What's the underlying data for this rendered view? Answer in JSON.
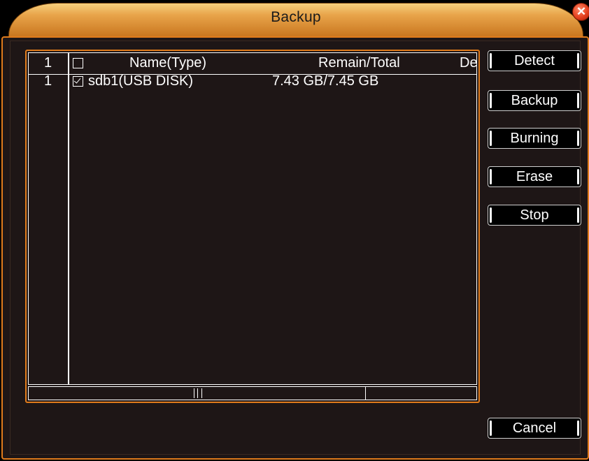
{
  "window": {
    "title": "Backup",
    "close_icon": "close-icon"
  },
  "table": {
    "headers": {
      "index": "1",
      "name": "Name(Type)",
      "remain_total": "Remain/Total",
      "desc": "De"
    },
    "rows": [
      {
        "index": "1",
        "checked": true,
        "name": "sdb1(USB DISK)",
        "remain_total": "7.43 GB/7.45 GB"
      }
    ]
  },
  "buttons": {
    "detect": "Detect",
    "backup": "Backup",
    "burning": "Burning",
    "erase": "Erase",
    "stop": "Stop",
    "cancel": "Cancel"
  },
  "colors": {
    "accent": "#e07b1c",
    "panel_bg": "#1e1616",
    "close": "#e4401e"
  }
}
